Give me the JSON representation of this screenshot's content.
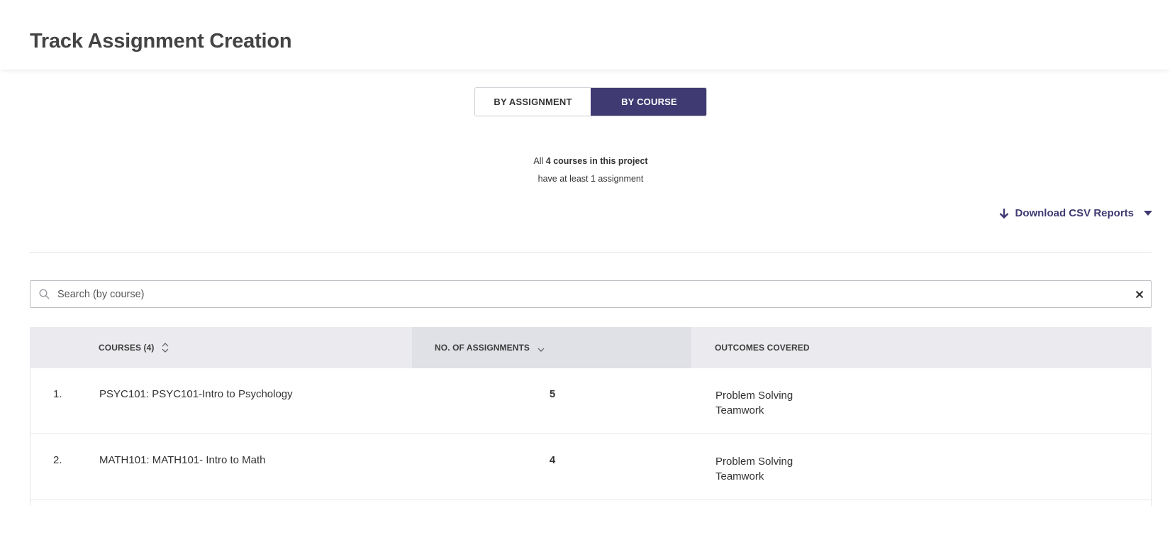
{
  "header": {
    "title": "Track Assignment Creation"
  },
  "toggle": {
    "by_assignment": "BY ASSIGNMENT",
    "by_course": "BY COURSE",
    "active": "by_course"
  },
  "summary": {
    "prefix": "All",
    "highlight": "4 courses in this project",
    "line2": "have at least 1 assignment"
  },
  "download": {
    "label": "Download CSV Reports"
  },
  "search": {
    "placeholder": "Search (by course)",
    "value": ""
  },
  "table": {
    "columns": {
      "courses": "COURSES (4)",
      "assignments": "NO. OF ASSIGNMENTS",
      "outcomes": "OUTCOMES COVERED"
    },
    "rows": [
      {
        "index": "1.",
        "course": "PSYC101: PSYC101-Intro to Psychology",
        "count": "5",
        "outcomes": [
          "Problem Solving",
          "Teamwork"
        ]
      },
      {
        "index": "2.",
        "course": "MATH101: MATH101- Intro to Math",
        "count": "4",
        "outcomes": [
          "Problem Solving",
          "Teamwork"
        ]
      }
    ]
  },
  "colors": {
    "accent": "#3f3a72",
    "header_bg": "#ebebef",
    "sorted_column_bg": "#dfe1e6"
  }
}
